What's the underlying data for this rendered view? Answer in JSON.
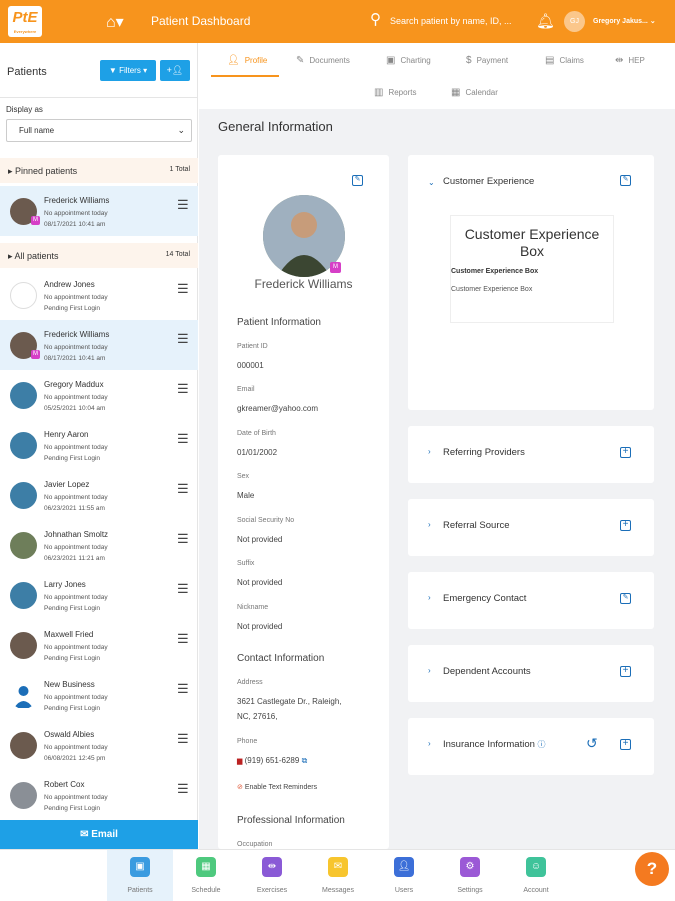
{
  "topbar": {
    "logo_text": "PtE",
    "logo_sub": "Everywhere",
    "title": "Patient Dashboard",
    "search_placeholder": "Search patient by name, ID, ...",
    "avatar_initials": "GJ",
    "user_name": "Gregory Jakus..."
  },
  "sidebar": {
    "title": "Patients",
    "filters_label": "Filters",
    "display_as_label": "Display as",
    "display_as_value": "Full name",
    "pinned": {
      "label": "Pinned patients",
      "count": "1 Total"
    },
    "all": {
      "label": "All patients",
      "count": "14 Total"
    },
    "pinned_patients": [
      {
        "name": "Frederick Williams",
        "line1": "No appointment today",
        "line2": "08/17/2021 10:41 am"
      }
    ],
    "patients": [
      {
        "name": "Andrew Jones",
        "line1": "No appointment today",
        "line2": "Pending First Login"
      },
      {
        "name": "Frederick Williams",
        "line1": "No appointment today",
        "line2": "08/17/2021 10:41 am"
      },
      {
        "name": "Gregory Maddux",
        "line1": "No appointment today",
        "line2": "05/25/2021 10:04 am"
      },
      {
        "name": "Henry Aaron",
        "line1": "No appointment today",
        "line2": "Pending First Login"
      },
      {
        "name": "Javier Lopez",
        "line1": "No appointment today",
        "line2": "06/23/2021 11:55 am"
      },
      {
        "name": "Johnathan Smoltz",
        "line1": "No appointment today",
        "line2": "06/23/2021 11:21 am"
      },
      {
        "name": "Larry Jones",
        "line1": "No appointment today",
        "line2": "Pending First Login"
      },
      {
        "name": "Maxwell Fried",
        "line1": "No appointment today",
        "line2": "Pending First Login"
      },
      {
        "name": "New Business",
        "line1": "No appointment today",
        "line2": "Pending First Login"
      },
      {
        "name": "Oswald Albies",
        "line1": "No appointment today",
        "line2": "06/08/2021 12:45 pm"
      },
      {
        "name": "Robert Cox",
        "line1": "No appointment today",
        "line2": "Pending First Login"
      }
    ],
    "email_label": "Email"
  },
  "tabs": {
    "profile": "Profile",
    "documents": "Documents",
    "charting": "Charting",
    "payment": "Payment",
    "claims": "Claims",
    "hep": "HEP",
    "reports": "Reports",
    "calendar": "Calendar"
  },
  "main": {
    "section_title": "General Information",
    "patient_name": "Frederick Williams",
    "patient_info_title": "Patient Information",
    "fields": {
      "patient_id_label": "Patient ID",
      "patient_id": "000001",
      "email_label": "Email",
      "email": "gkreamer@yahoo.com",
      "dob_label": "Date of Birth",
      "dob": "01/01/2002",
      "sex_label": "Sex",
      "sex": "Male",
      "ssn_label": "Social Security No",
      "ssn": "Not provided",
      "suffix_label": "Suffix",
      "suffix": "Not provided",
      "nickname_label": "Nickname",
      "nickname": "Not provided"
    },
    "contact_title": "Contact Information",
    "address_label": "Address",
    "address_line1": "3621 Castlegate Dr., Raleigh,",
    "address_line2": "NC, 27616,",
    "phone_label": "Phone",
    "phone": "(919) 651-6289",
    "text_reminders": "Enable Text Reminders",
    "professional_title": "Professional Information",
    "occupation_label": "Occupation"
  },
  "right": {
    "customer_experience": "Customer Experience",
    "ce_box_title": "Customer Experience Box",
    "ce_box_bold": "Customer Experience Box",
    "ce_box_text": "Customer Experience Box",
    "referring_providers": "Referring Providers",
    "referral_source": "Referral Source",
    "emergency_contact": "Emergency Contact",
    "dependent_accounts": "Dependent Accounts",
    "insurance_information": "Insurance Information"
  },
  "bottom_nav": {
    "patients": "Patients",
    "schedule": "Schedule",
    "exercises": "Exercises",
    "messages": "Messages",
    "users": "Users",
    "settings": "Settings",
    "account": "Account"
  },
  "colors": {
    "brand_orange": "#f7941d",
    "accent_blue": "#1ea0e6",
    "icon_blue": "#1b6eb8"
  }
}
